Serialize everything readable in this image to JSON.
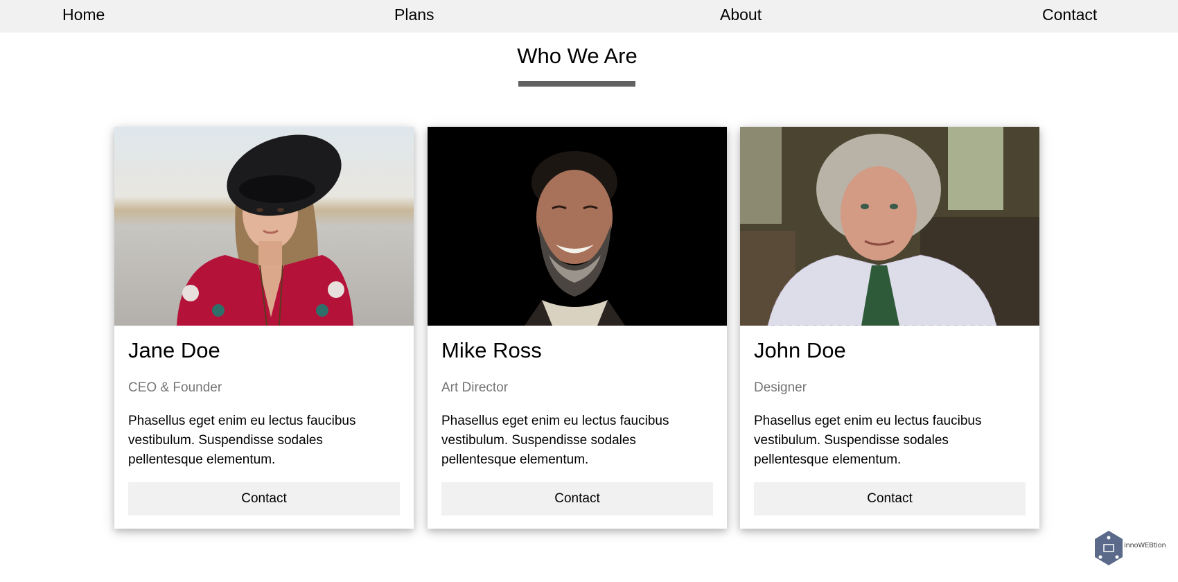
{
  "nav": {
    "items": [
      {
        "label": "Home"
      },
      {
        "label": "Plans"
      },
      {
        "label": "About"
      },
      {
        "label": "Contact"
      }
    ]
  },
  "section": {
    "title": "Who We Are"
  },
  "team": [
    {
      "name": "Jane Doe",
      "role": "CEO & Founder",
      "bio": "Phasellus eget enim eu lectus faucibus vestibulum. Suspendisse sodales pellentesque elementum.",
      "button_label": "Contact",
      "photo": "woman-in-black-hat-portrait"
    },
    {
      "name": "Mike Ross",
      "role": "Art Director",
      "bio": "Phasellus eget enim eu lectus faucibus vestibulum. Suspendisse sodales pellentesque elementum.",
      "button_label": "Contact",
      "photo": "smiling-bearded-man-dark-background"
    },
    {
      "name": "John Doe",
      "role": "Designer",
      "bio": "Phasellus eget enim eu lectus faucibus vestibulum. Suspendisse sodales pellentesque elementum.",
      "button_label": "Contact",
      "photo": "grey-haired-man-checked-shirt"
    }
  ],
  "logo": {
    "text": "innoWEBtion"
  },
  "colors": {
    "navbar_bg": "#f1f1f1",
    "underline": "#616161",
    "role_text": "#757575",
    "button_bg": "#f1f1f1",
    "logo": "#5b6a8a"
  }
}
